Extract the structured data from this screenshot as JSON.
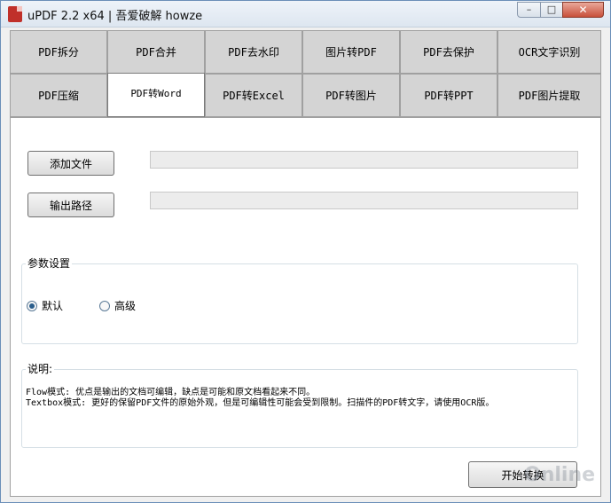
{
  "window": {
    "title": "uPDF 2.2 x64 | 吾爱破解 howze"
  },
  "controls": {
    "minimize": "–",
    "maximize": "□",
    "close": "✕"
  },
  "tabs_row1": [
    "PDF拆分",
    "PDF合并",
    "PDF去水印",
    "图片转PDF",
    "PDF去保护",
    "OCR文字识别"
  ],
  "tabs_row2": [
    "PDF压缩",
    "PDF转Word",
    "PDF转Excel",
    "PDF转图片",
    "PDF转PPT",
    "PDF图片提取"
  ],
  "active_tab": "PDF转Word",
  "actions": {
    "add_file": "添加文件",
    "output_path": "输出路径",
    "start": "开始转换"
  },
  "fields": {
    "file_path": "",
    "output_path": ""
  },
  "settings": {
    "label": "参数设置",
    "options": [
      {
        "label": "默认",
        "checked": true
      },
      {
        "label": "高级",
        "checked": false
      }
    ]
  },
  "description": {
    "label": "说明:",
    "lines": [
      "Flow模式: 优点是输出的文档可编辑，缺点是可能和原文档看起来不同。",
      "Textbox模式: 更好的保留PDF文件的原始外观，但是可编辑性可能会受到限制。扫描件的PDF转文字，请使用OCR版。"
    ]
  },
  "watermark": "Online"
}
